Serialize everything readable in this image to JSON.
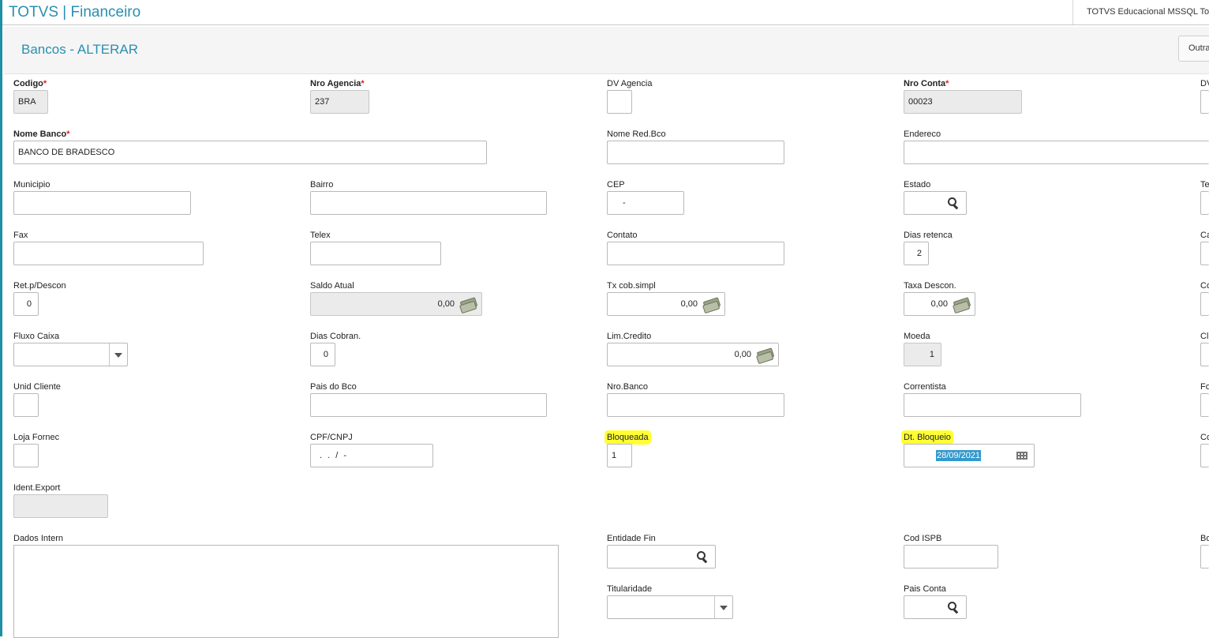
{
  "app": {
    "title": "TOTVS | Financeiro",
    "environment": "TOTVS Educacional MSSQL Totvs"
  },
  "header": {
    "page_title": "Bancos - ALTERAR",
    "outras_button": "Outras"
  },
  "fields": {
    "codigo": {
      "label": "Codigo",
      "value": "BRA"
    },
    "nro_agencia": {
      "label": "Nro Agencia",
      "value": "237"
    },
    "dv_agencia": {
      "label": "DV Agencia",
      "value": ""
    },
    "nro_conta": {
      "label": "Nro Conta",
      "value": "00023"
    },
    "dv_conta": {
      "label": "DV",
      "value": ""
    },
    "nome_banco": {
      "label": "Nome Banco",
      "value": "BANCO DE BRADESCO"
    },
    "nome_red_bco": {
      "label": "Nome Red.Bco",
      "value": ""
    },
    "endereco": {
      "label": "Endereco",
      "value": ""
    },
    "municipio": {
      "label": "Municipio",
      "value": ""
    },
    "bairro": {
      "label": "Bairro",
      "value": ""
    },
    "cep": {
      "label": "CEP",
      "value": "-"
    },
    "estado": {
      "label": "Estado",
      "value": ""
    },
    "telefone": {
      "label": "Te",
      "value": ""
    },
    "fax": {
      "label": "Fax",
      "value": ""
    },
    "telex": {
      "label": "Telex",
      "value": ""
    },
    "contato": {
      "label": "Contato",
      "value": ""
    },
    "dias_retenca": {
      "label": "Dias retenca",
      "value": "2"
    },
    "col5_row4": {
      "label": "Ca",
      "value": ""
    },
    "ret_p_descon": {
      "label": "Ret.p/Descon",
      "value": "0"
    },
    "saldo_atual": {
      "label": "Saldo Atual",
      "value": "0,00"
    },
    "tx_cob_simpl": {
      "label": "Tx cob.simpl",
      "value": "0,00"
    },
    "taxa_descon": {
      "label": "Taxa Descon.",
      "value": "0,00"
    },
    "col5_row5": {
      "label": "Co",
      "value": ""
    },
    "fluxo_caixa": {
      "label": "Fluxo Caixa",
      "value": ""
    },
    "dias_cobran": {
      "label": "Dias Cobran.",
      "value": "0"
    },
    "lim_credito": {
      "label": "Lim.Credito",
      "value": "0,00"
    },
    "moeda": {
      "label": "Moeda",
      "value": "1"
    },
    "col5_row6": {
      "label": "Cli",
      "value": ""
    },
    "unid_cliente": {
      "label": "Unid Cliente",
      "value": ""
    },
    "pais_do_bco": {
      "label": "Pais do Bco",
      "value": ""
    },
    "nro_banco": {
      "label": "Nro.Banco",
      "value": ""
    },
    "correntista": {
      "label": "Correntista",
      "value": ""
    },
    "col5_row7": {
      "label": "Fo",
      "value": ""
    },
    "loja_fornec": {
      "label": "Loja Fornec",
      "value": ""
    },
    "cpf_cnpj": {
      "label": "CPF/CNPJ",
      "value": ". . / -"
    },
    "bloqueada": {
      "label": "Bloqueada",
      "value": "1"
    },
    "dt_bloqueio": {
      "label": "Dt. Bloqueio",
      "value": "28/09/2021"
    },
    "col5_row8": {
      "label": "Co",
      "value": ""
    },
    "ident_export": {
      "label": "Ident.Export",
      "value": ""
    },
    "dados_intern": {
      "label": "Dados Intern",
      "value": ""
    },
    "entidade_fin": {
      "label": "Entidade Fin",
      "value": ""
    },
    "cod_ispb": {
      "label": "Cod ISPB",
      "value": ""
    },
    "col5_row10": {
      "label": "Bo",
      "value": ""
    },
    "titularidade": {
      "label": "Titularidade",
      "value": ""
    },
    "pais_conta": {
      "label": "Pais Conta",
      "value": ""
    }
  }
}
